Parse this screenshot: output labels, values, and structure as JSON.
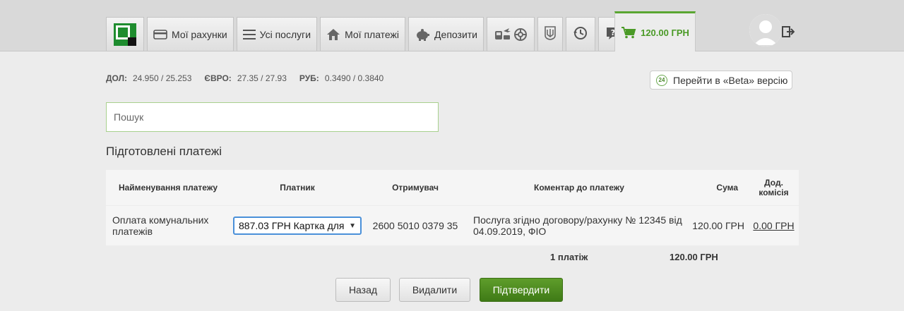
{
  "nav": {
    "tabs": [
      {
        "label": "Мої рахунки",
        "icon": "card-icon"
      },
      {
        "label": "Усі послуги",
        "icon": "list-icon"
      },
      {
        "label": "Мої платежі",
        "icon": "house-icon"
      },
      {
        "label": "Депозити",
        "icon": "piggy-bank-icon"
      }
    ],
    "cart_total": "120.00 ГРН"
  },
  "rates": {
    "usd_label": "ДОЛ:",
    "usd_value": "24.950 / 25.253",
    "eur_label": "ЄВРО:",
    "eur_value": "27.35 / 27.93",
    "rub_label": "РУБ:",
    "rub_value": "0.3490 / 0.3840"
  },
  "beta": {
    "badge": "24",
    "label": "Перейти в «Beta» версію"
  },
  "search": {
    "placeholder": "Пошук"
  },
  "section_title": "Підготовлені платежі",
  "table": {
    "headers": {
      "name": "Найменування платежу",
      "payer": "Платник",
      "recipient": "Отримувач",
      "comment": "Коментар до платежу",
      "amount": "Сума",
      "fee_line1": "Дод.",
      "fee_line2": "комісія"
    },
    "rows": [
      {
        "name": "Оплата комунальних платежів",
        "payer": "887.03 ГРН  Картка для",
        "recipient": "2600 5010 0379 35",
        "comment": "Послуга згідно договору/рахунку № 12345 від 04.09.2019, ФІО",
        "amount": "120.00 ГРН",
        "fee": "0.00 ГРН"
      }
    ],
    "total_count": "1 платіж",
    "total_amount": "120.00 ГРН"
  },
  "buttons": {
    "back": "Назад",
    "delete": "Видалити",
    "confirm": "Підтвердити"
  },
  "colors": {
    "accent_green": "#4a9a26",
    "confirm_green": "#4f8c21",
    "focus_blue": "#4a90d9"
  }
}
